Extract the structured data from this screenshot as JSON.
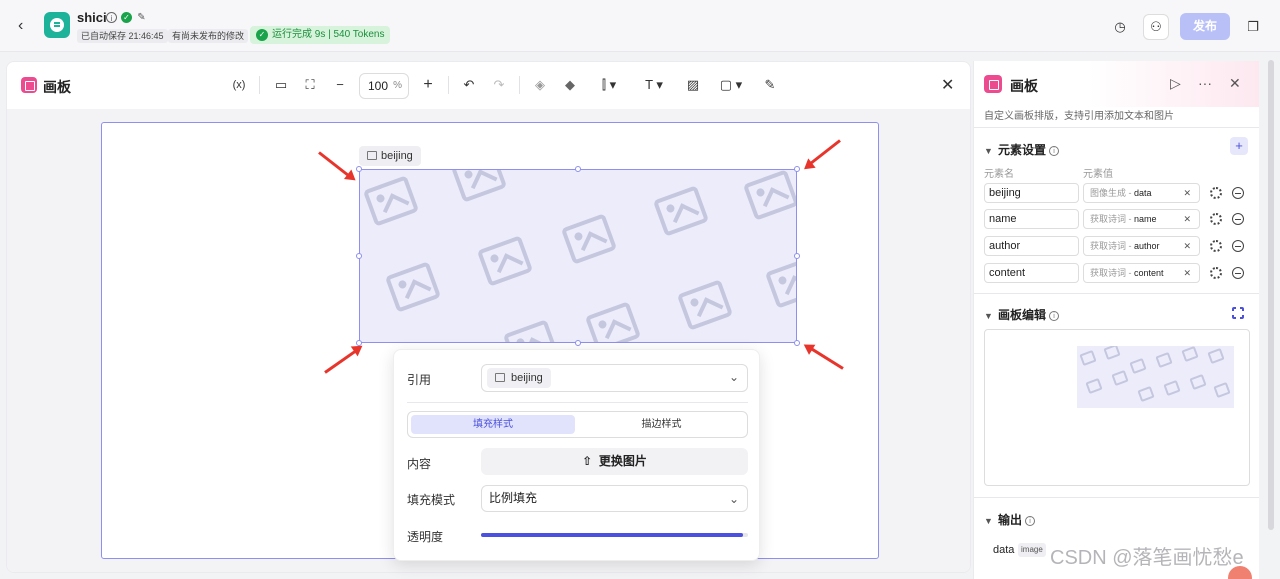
{
  "topbar": {
    "app_name": "shici",
    "autosave": "已自动保存 21:46:45",
    "unpublished": "有尚未发布的修改",
    "run_status": "运行完成 9s | 540 Tokens",
    "publish_label": "发布",
    "icons": [
      "back-icon",
      "app-logo",
      "info-icon",
      "verified-icon",
      "edit-icon",
      "history-icon",
      "collaborate-icon",
      "window-icon"
    ]
  },
  "canvas_panel": {
    "title": "画板",
    "variable_tool": "(x)",
    "zoom_value": "100",
    "zoom_unit": "%",
    "text_tool": "T",
    "element_label": "beijing"
  },
  "popup": {
    "ref_label": "引用",
    "ref_value": "beijing",
    "tab_fill": "填充样式",
    "tab_stroke": "描边样式",
    "content_label": "内容",
    "replace_label": "更换图片",
    "fill_mode_label": "填充模式",
    "fill_mode_value": "比例填充",
    "opacity_label": "透明度",
    "opacity_value": 0.98
  },
  "right_panel": {
    "title": "画板",
    "description": "自定义画板排版，支持引用添加文本和图片",
    "element_settings_title": "元素设置",
    "col_name": "元素名",
    "col_value": "元素值",
    "elements": [
      {
        "name": "beijing",
        "source": "图像生成 -",
        "field": "data"
      },
      {
        "name": "name",
        "source": "获取诗词 -",
        "field": "name"
      },
      {
        "name": "author",
        "source": "获取诗词 -",
        "field": "author"
      },
      {
        "name": "content",
        "source": "获取诗词 -",
        "field": "content"
      }
    ],
    "canvas_edit_title": "画板编辑",
    "output_title": "输出",
    "output_name": "data",
    "output_type": "image"
  },
  "watermark": "CSDN @落笔画忧愁e",
  "colors": {
    "accent": "#4c50e0",
    "brand": "#1db39a",
    "canvas_icon": "#ec4c8f",
    "success": "#19a34a",
    "arrow": "#e8352c"
  }
}
